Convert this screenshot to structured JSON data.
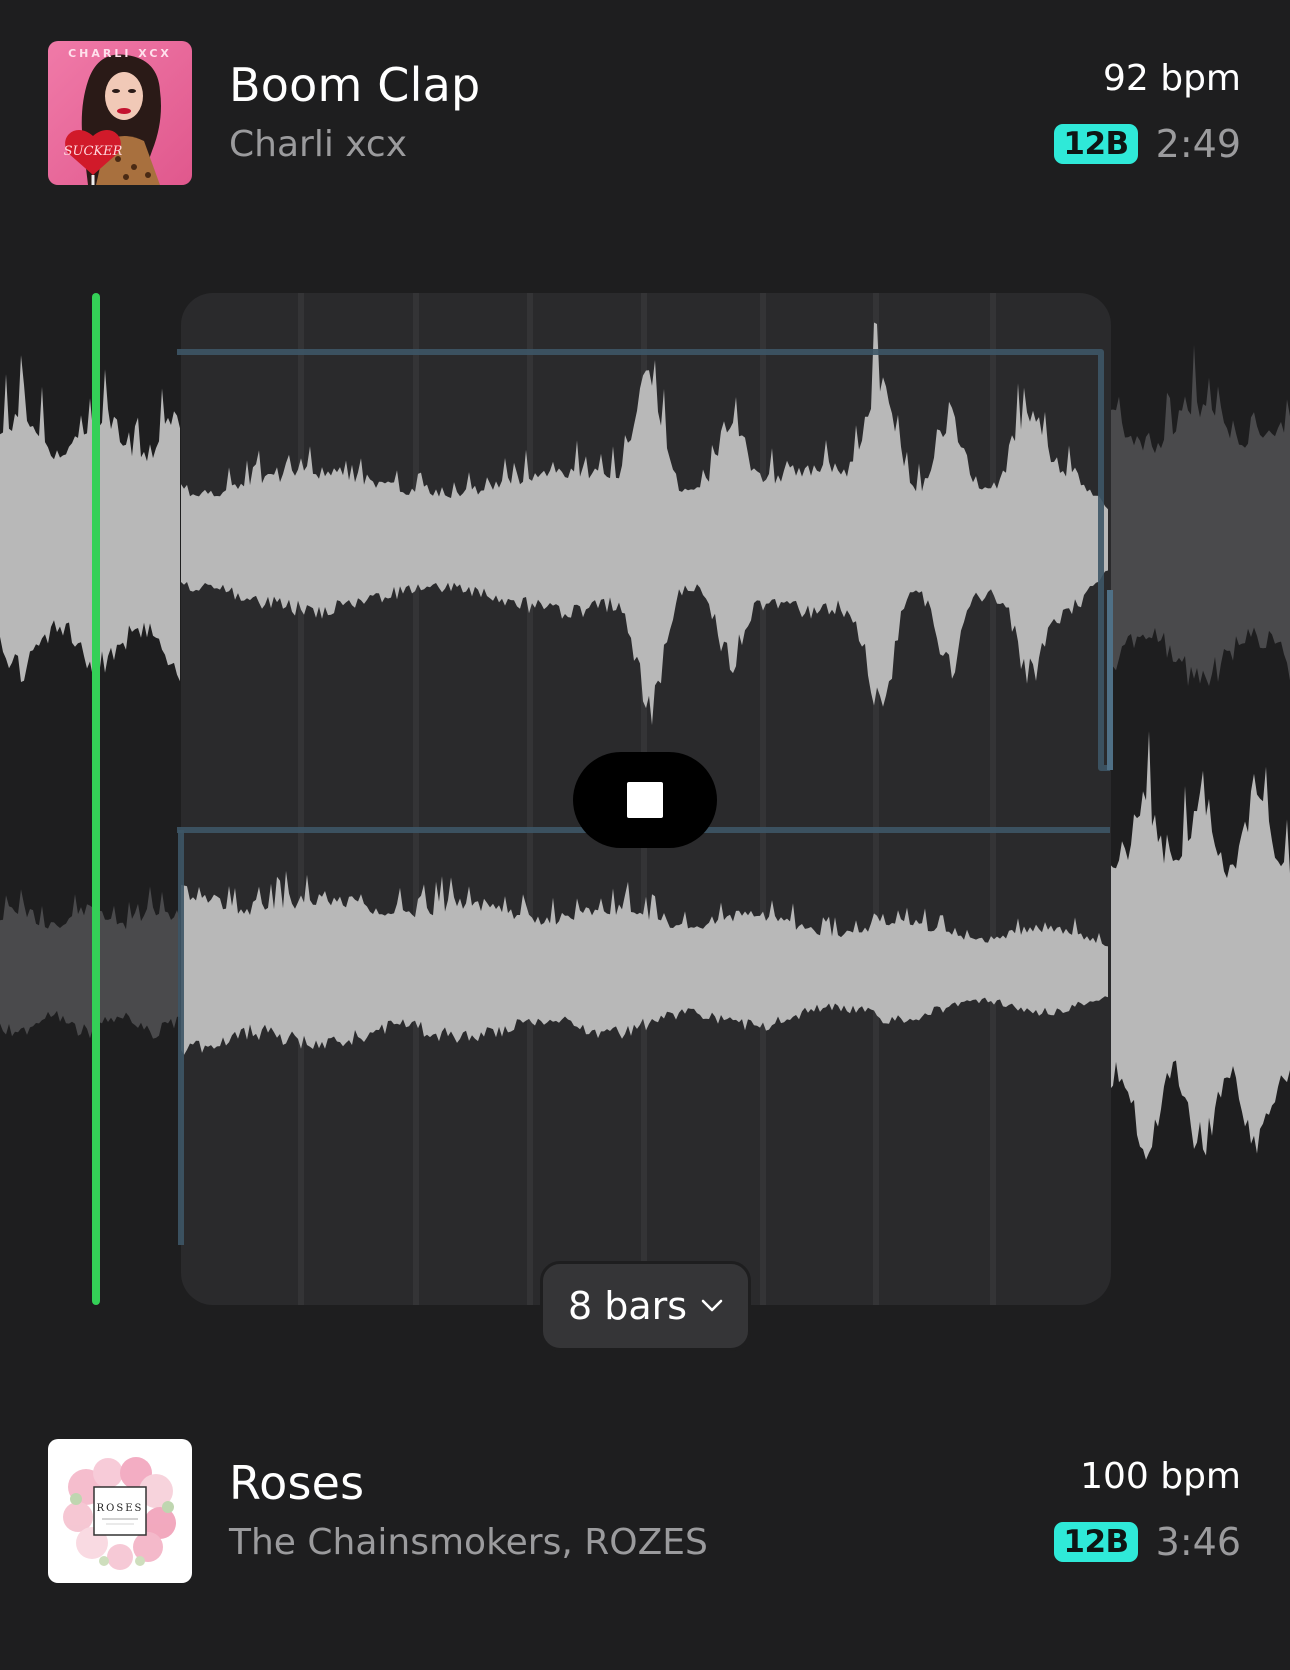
{
  "tracks": [
    {
      "title": "Boom Clap",
      "artist": "Charli xcx",
      "bpm": "92 bpm",
      "key": "12B",
      "duration": "2:49",
      "artwork_text": "CHARLI XCX"
    },
    {
      "title": "Roses",
      "artist": "The Chainsmokers, ROZES",
      "bpm": "100 bpm",
      "key": "12B",
      "duration": "3:46",
      "artwork_text": "ROSES"
    }
  ],
  "transition": {
    "length_label": "8 bars",
    "stop_icon": "stop-icon",
    "dropdown_icon": "chevron-down-icon"
  },
  "colors": {
    "background": "#1e1e1f",
    "playhead": "#34d057",
    "key_badge": "#2fe9d8",
    "waveform": "#b8b8b8",
    "waveform_dim": "#545456",
    "automation_line": "#3d5566",
    "selection_panel": "#2a2a2c"
  }
}
